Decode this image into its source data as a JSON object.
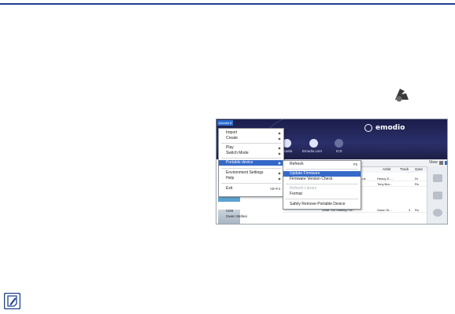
{
  "brand": {
    "name": "emodio"
  },
  "app_menu": {
    "label": "emodio ▾"
  },
  "nav": [
    {
      "label": "...casts"
    },
    {
      "label": "Emodio.com"
    },
    {
      "label": "ICS"
    }
  ],
  "main_menu": {
    "items": [
      {
        "label": "Import",
        "submenu": true
      },
      {
        "label": "Create",
        "submenu": true
      },
      {
        "label": "Play",
        "submenu": true
      },
      {
        "label": "Switch Mode",
        "submenu": true
      },
      {
        "label": "Portable device",
        "submenu": true,
        "highlighted": true
      },
      {
        "label": "Environment Settings",
        "submenu": true
      },
      {
        "label": "Help",
        "submenu": true
      },
      {
        "label": "Exit",
        "shortcut": "Alt+F4"
      }
    ]
  },
  "sub_menu": {
    "items": [
      {
        "label": "Refresh",
        "shortcut": "F5"
      },
      {
        "label": "Update Firmware",
        "highlighted": true
      },
      {
        "label": "Firmware Version Check"
      },
      {
        "label": "Refresh Library",
        "disabled": true
      },
      {
        "label": "Format"
      },
      {
        "label": "Safely Remove Portable Device"
      }
    ]
  },
  "toolbar": {
    "view_label": "View"
  },
  "columns": {
    "artist": "Artist",
    "track": "Track",
    "genre": "Genr"
  },
  "rows": [
    {
      "a": "...ue",
      "b": "Heavy-D ...",
      "c": "",
      "d": "Dr"
    },
    {
      "a": "",
      "b": "Tony Bra...",
      "c": "",
      "d": "Ro"
    },
    {
      "a": "What You Waiting For?",
      "b": "Gwen St...",
      "c": "3",
      "d": "Ro"
    }
  ],
  "album": {
    "title": "CD9",
    "artist": "Gwen Stefani"
  },
  "colors": {
    "accent": "#3569c8",
    "banner": "#1b1e4a",
    "rule": "#1f3f8f"
  },
  "icons": [
    "emodio-app-icon",
    "note-icon",
    "side-device-icon",
    "side-folder-icon",
    "side-disc-icon"
  ]
}
